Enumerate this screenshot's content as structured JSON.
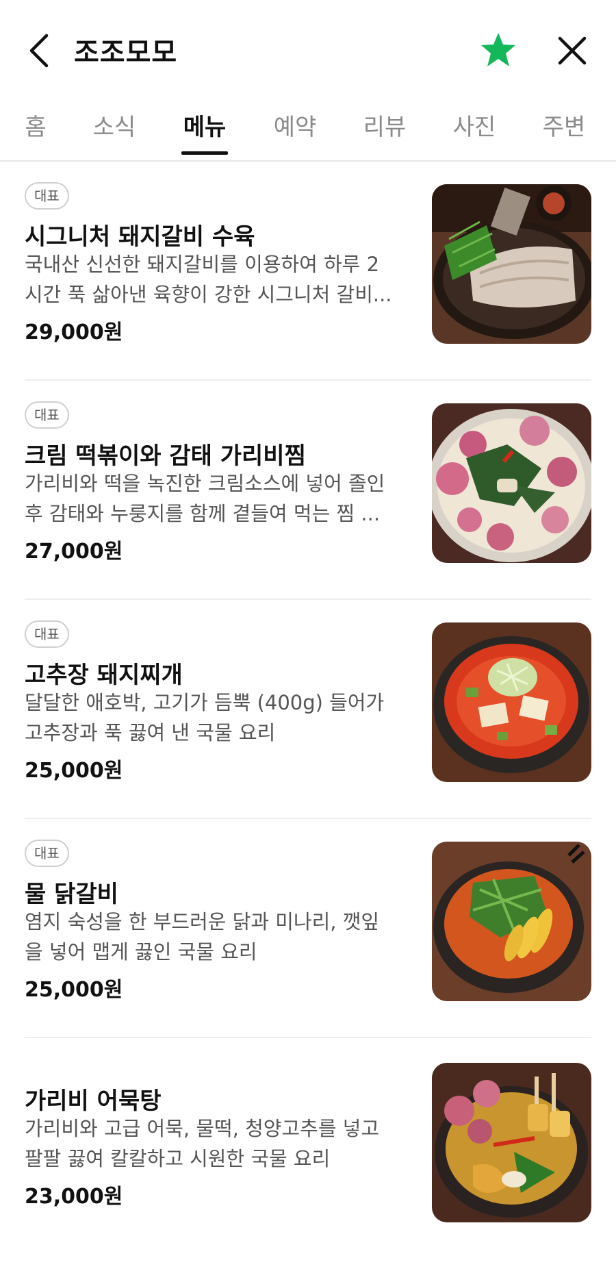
{
  "header": {
    "title": "조조모모",
    "icons": [
      "back-arrow-icon",
      "star-icon",
      "close-icon"
    ],
    "star_color": "#14b85a"
  },
  "tabs": [
    {
      "label": "홈",
      "active": false
    },
    {
      "label": "소식",
      "active": false
    },
    {
      "label": "메뉴",
      "active": true
    },
    {
      "label": "예약",
      "active": false
    },
    {
      "label": "리뷰",
      "active": false
    },
    {
      "label": "사진",
      "active": false
    },
    {
      "label": "주변",
      "active": false
    }
  ],
  "menu": [
    {
      "badge": "대표",
      "name": "시그니처 돼지갈비 수육",
      "desc_line1": "국내산 신선한 돼지갈비를 이용하여 하루 2",
      "desc_line2": "시간 푹 삶아낸 육향이 강한 시그니처 갈비...",
      "price": "29,000",
      "currency": "원",
      "image": "pork-rib-suyuk-photo"
    },
    {
      "badge": "대표",
      "name": "크림 떡볶이와 감태 가리비찜",
      "desc_line1": "가리비와 떡을 녹진한 크림소스에 넣어 졸인",
      "desc_line2": "후 감태와 누룽지를 함께 곁들여 먹는 찜 ...",
      "price": "27,000",
      "currency": "원",
      "image": "scallop-tteokbokki-photo"
    },
    {
      "badge": "대표",
      "name": "고추장 돼지찌개",
      "desc_line1": "달달한 애호박, 고기가 듬뿍 (400g) 들어가",
      "desc_line2": "고추장과 푹 끓여 낸 국물 요리",
      "price": "25,000",
      "currency": "원",
      "image": "gochujang-stew-photo"
    },
    {
      "badge": "대표",
      "name": "물 닭갈비",
      "desc_line1": "염지 숙성을 한 부드러운 닭과 미나리, 깻잎",
      "desc_line2": "을 넣어 맵게 끓인 국물 요리",
      "price": "25,000",
      "currency": "원",
      "image": "mul-dakgalbi-photo"
    },
    {
      "badge": "",
      "name": "가리비 어묵탕",
      "desc_line1": "가리비와 고급 어묵, 물떡, 청양고추를 넣고",
      "desc_line2": "팔팔 끓여 칼칼하고 시원한 국물 요리",
      "price": "23,000",
      "currency": "원",
      "image": "scallop-fishcake-soup-photo"
    }
  ]
}
